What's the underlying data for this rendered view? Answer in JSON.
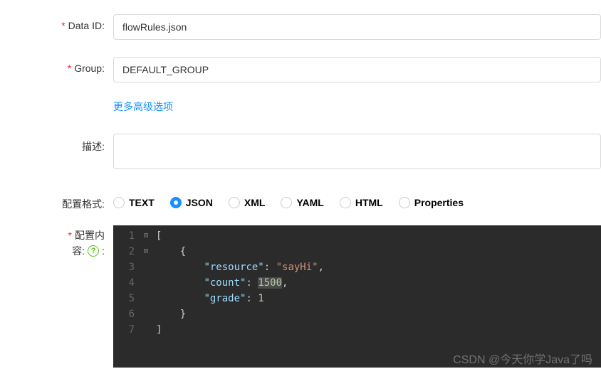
{
  "form": {
    "dataId": {
      "label": "Data ID:",
      "value": "flowRules.json",
      "required": true
    },
    "group": {
      "label": "Group:",
      "value": "DEFAULT_GROUP",
      "required": true
    },
    "moreOptions": {
      "label": "更多高级选项"
    },
    "description": {
      "label": "描述:",
      "value": ""
    },
    "configFormat": {
      "label": "配置格式:",
      "options": [
        "TEXT",
        "JSON",
        "XML",
        "YAML",
        "HTML",
        "Properties"
      ],
      "selected": "JSON"
    },
    "configContent": {
      "label_part1": "配置内",
      "label_part2": "容:",
      "required": true
    }
  },
  "code": {
    "lines": [
      {
        "num": 1,
        "fold": "⊟",
        "indent": 0,
        "tokens": [
          {
            "t": "punc",
            "v": "["
          }
        ]
      },
      {
        "num": 2,
        "fold": "⊟",
        "indent": 2,
        "tokens": [
          {
            "t": "punc",
            "v": "{"
          }
        ]
      },
      {
        "num": 3,
        "fold": "",
        "indent": 4,
        "tokens": [
          {
            "t": "key",
            "v": "\"resource\""
          },
          {
            "t": "punc",
            "v": ": "
          },
          {
            "t": "str",
            "v": "\"sayHi\""
          },
          {
            "t": "punc",
            "v": ","
          }
        ]
      },
      {
        "num": 4,
        "fold": "",
        "indent": 4,
        "tokens": [
          {
            "t": "key",
            "v": "\"count\""
          },
          {
            "t": "punc",
            "v": ": "
          },
          {
            "t": "numhl",
            "v": "1500"
          },
          {
            "t": "punc",
            "v": ","
          }
        ]
      },
      {
        "num": 5,
        "fold": "",
        "indent": 4,
        "tokens": [
          {
            "t": "key",
            "v": "\"grade\""
          },
          {
            "t": "punc",
            "v": ": "
          },
          {
            "t": "num",
            "v": "1"
          }
        ]
      },
      {
        "num": 6,
        "fold": "",
        "indent": 2,
        "tokens": [
          {
            "t": "punc",
            "v": "}"
          }
        ]
      },
      {
        "num": 7,
        "fold": "",
        "indent": 0,
        "tokens": [
          {
            "t": "punc",
            "v": "]"
          }
        ]
      }
    ]
  },
  "watermark": "CSDN @今天你学Java了吗"
}
